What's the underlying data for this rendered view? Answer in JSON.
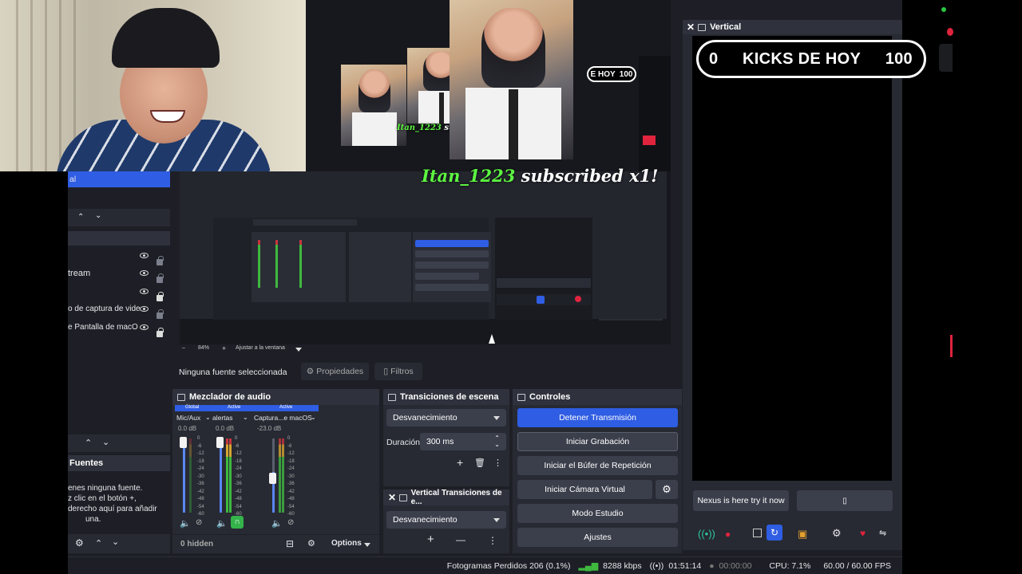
{
  "webcam": {},
  "scene_list": {
    "selected_item": "al"
  },
  "sources": {
    "title": "Fuentes",
    "items": [
      {
        "label": "tream"
      },
      {
        "label": ""
      },
      {
        "label": "o de captura de vide"
      },
      {
        "label": "e Pantalla de macO"
      }
    ],
    "empty_text": [
      "enes ninguna fuente.",
      "z clic en el botón +,",
      "derecho aquí para añadir",
      "una."
    ]
  },
  "preview": {
    "overlay_subscribe": {
      "name": "Itan_1223",
      "text": " subscribed x1!",
      "name_small": "Itan_1223",
      "text_small": " subscribe"
    },
    "overlay_kicks_partial": "E HOY",
    "overlay_kicks_num": "100",
    "zoom": {
      "minus": "–",
      "value": "84%",
      "plus": "+",
      "fit": "Ajustar a la ventana"
    }
  },
  "source_toolbar": {
    "no_source": "Ninguna fuente seleccionada",
    "properties": "Propiedades",
    "filters": "Filtros"
  },
  "audio_mixer": {
    "title": "Mezclador de audio",
    "tabs": [
      "Global",
      "Active",
      "Active"
    ],
    "channels": [
      {
        "name": "Mic/Aux",
        "db": "0.0 dB"
      },
      {
        "name": "alertas",
        "db": "0.0 dB"
      },
      {
        "name": "Captura...e macOS",
        "db": "-23.0 dB"
      }
    ],
    "scale": [
      "0",
      "-6",
      "-12",
      "-18",
      "-24",
      "-30",
      "-36",
      "-42",
      "-48",
      "-54",
      "-60"
    ],
    "hidden": "0 hidden",
    "options": "Options"
  },
  "transitions": {
    "title": "Transiciones de escena",
    "selected": "Desvanecimiento",
    "duration_label": "Duración",
    "duration_value": "300 ms"
  },
  "vertical_transitions": {
    "title": "Vertical Transiciones de e...",
    "selected": "Desvanecimiento"
  },
  "controls": {
    "title": "Controles",
    "stop_stream": "Detener Transmisión",
    "start_recording": "Iniciar Grabación",
    "replay_buffer": "Iniciar el Búfer de Repetición",
    "virtual_cam": "Iniciar Cámara Virtual",
    "studio_mode": "Modo Estudio",
    "settings": "Ajustes"
  },
  "vertical": {
    "title": "Vertical",
    "kicks_left": "0",
    "kicks_label": "KICKS DE HOY",
    "kicks_right": "100",
    "nexus_button": "Nexus is here try it now",
    "blank_button": "▯"
  },
  "status": {
    "dropped": "Fotogramas Perdidos 206 (0.1%)",
    "bitrate": "8288 kbps",
    "stream_time": "01:51:14",
    "rec_time": "00:00:00",
    "cpu": "CPU: 7.1%",
    "fps": "60.00 / 60.00 FPS"
  },
  "colors": {
    "accent_blue": "#2f5de3",
    "kick_green": "#5df542",
    "record_red": "#e0243d",
    "panel_bg": "#272a33"
  }
}
